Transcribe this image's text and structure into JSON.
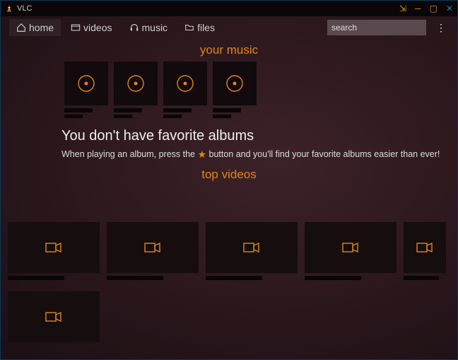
{
  "titlebar": {
    "title": "VLC"
  },
  "nav": {
    "home": "home",
    "videos": "videos",
    "music": "music",
    "files": "files"
  },
  "search": {
    "placeholder": "search"
  },
  "sections": {
    "your_music": "your music",
    "top_videos": "top videos"
  },
  "favorites": {
    "heading": "You don't have favorite albums",
    "hint_before": "When playing an album, press the ",
    "hint_after": " button and you'll find your favorite albums easier than ever!"
  },
  "colors": {
    "accent": "#e0861a"
  },
  "albums": [
    {
      "title": "",
      "artist": ""
    },
    {
      "title": "",
      "artist": ""
    },
    {
      "title": "",
      "artist": ""
    },
    {
      "title": "",
      "artist": ""
    }
  ],
  "videos_row1": [
    {
      "title": ""
    },
    {
      "title": ""
    },
    {
      "title": ""
    },
    {
      "title": ""
    },
    {
      "title": ""
    }
  ],
  "videos_row2": [
    {
      "title": ""
    }
  ]
}
